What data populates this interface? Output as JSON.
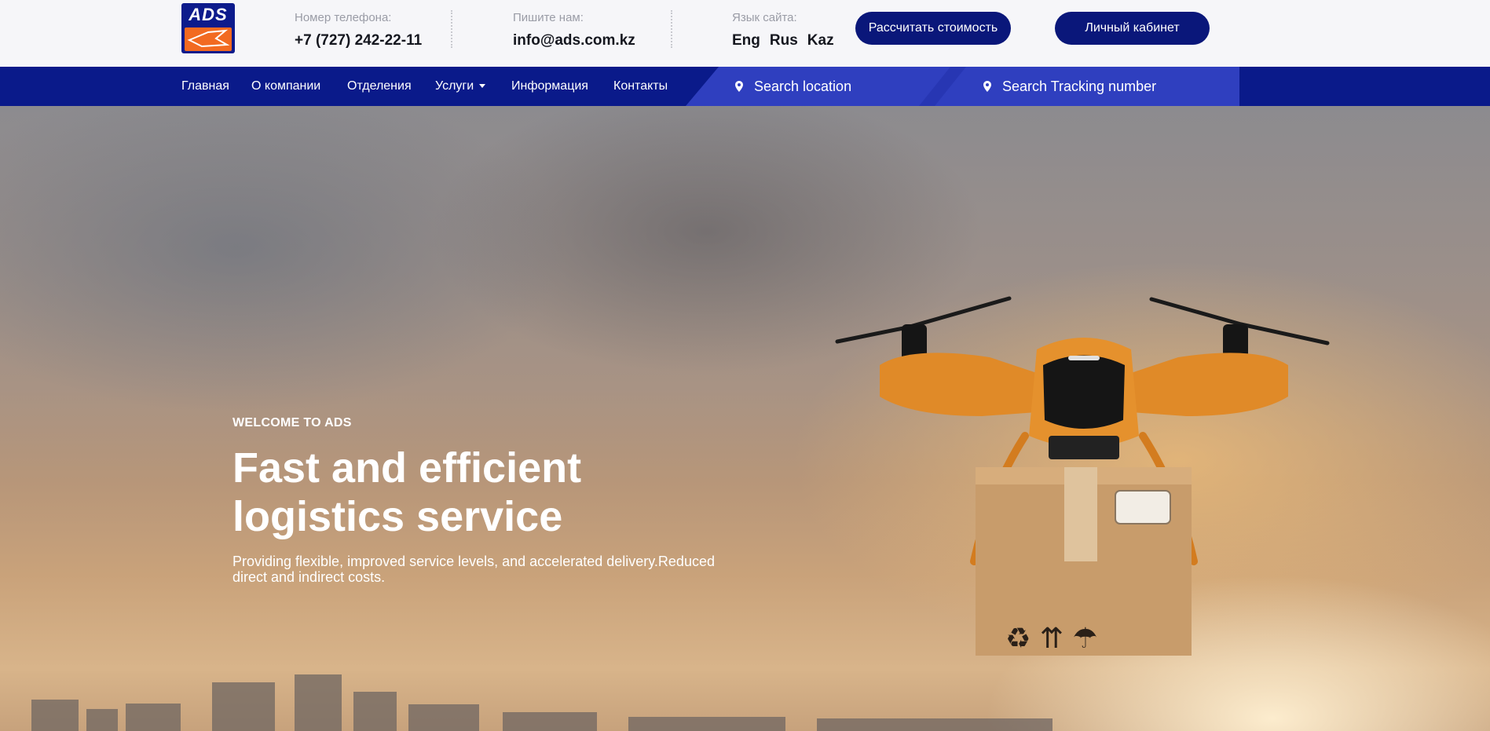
{
  "brand": {
    "logo_text": "ADS"
  },
  "header": {
    "phone_label": "Номер телефона:",
    "phone_value": "+7 (727) 242-22-11",
    "email_label": "Пишите нам:",
    "email_value": "info@ads.com.kz",
    "lang_label": "Язык сайта:",
    "languages": [
      "Eng",
      "Rus",
      "Kaz"
    ],
    "calc_button": "Рассчитать стоимость",
    "account_button": "Личный кабинет"
  },
  "nav": {
    "items": [
      "Главная",
      "О компании",
      "Отделения",
      "Услуги",
      "Информация",
      "Контакты"
    ],
    "search_location": "Search location",
    "search_tracking": "Search Tracking number"
  },
  "hero": {
    "kicker": "WELCOME TO ADS",
    "headline": "Fast and efficient logistics service",
    "subtext": "Providing flexible, improved service levels, and accelerated delivery.Reduced direct and indirect costs."
  },
  "colors": {
    "brand_navy": "#0a177a",
    "nav_blue": "#0a1a8a",
    "search_blue": "#2f3fbf",
    "logo_orange": "#f26a21",
    "drone_orange": "#e08a28"
  }
}
